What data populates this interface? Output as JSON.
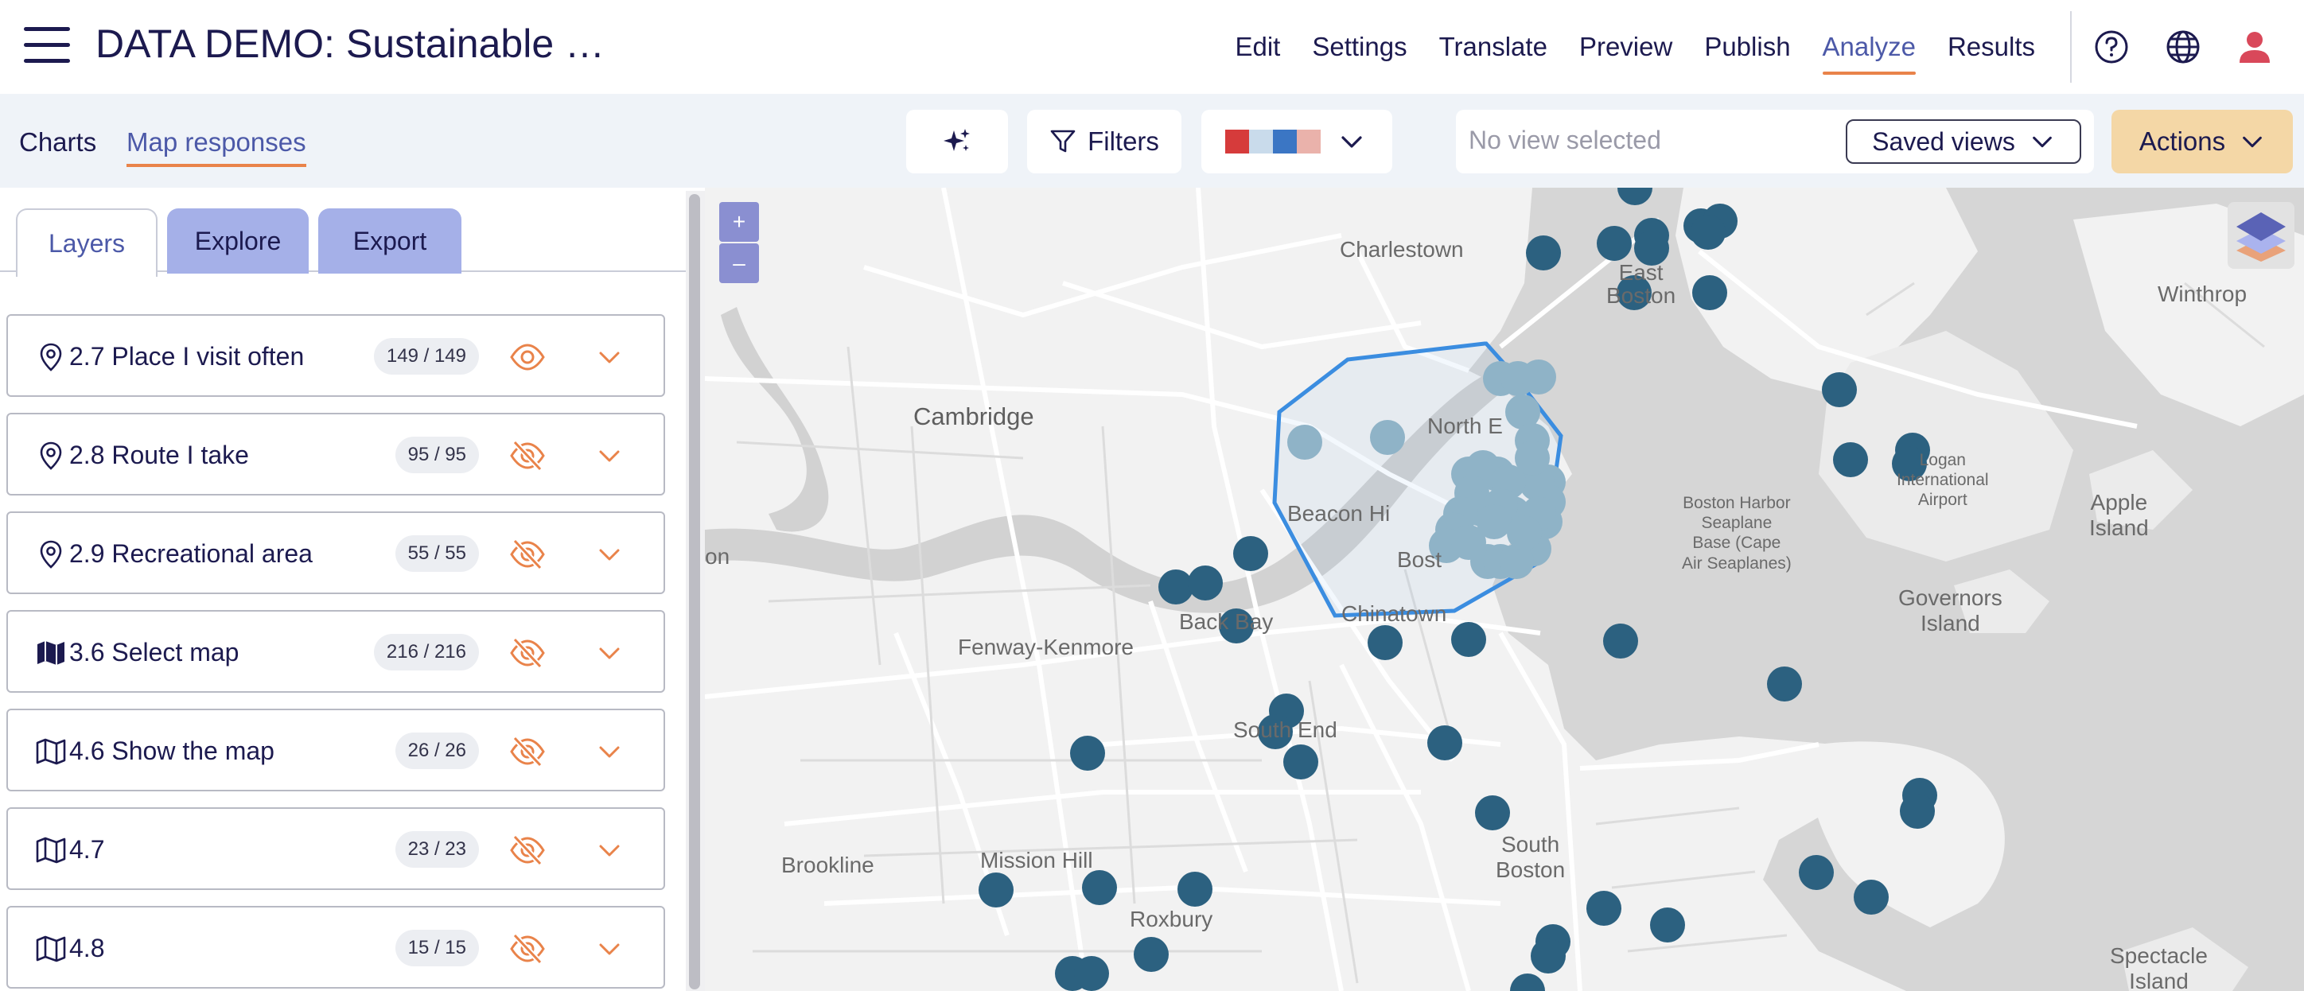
{
  "header": {
    "title": "DATA DEMO: Sustainable …",
    "nav": [
      {
        "label": "Edit"
      },
      {
        "label": "Settings"
      },
      {
        "label": "Translate"
      },
      {
        "label": "Preview"
      },
      {
        "label": "Publish"
      },
      {
        "label": "Analyze",
        "active": true
      },
      {
        "label": "Results"
      }
    ],
    "icons": [
      "help-icon",
      "globe-icon",
      "user-icon"
    ]
  },
  "subbar": {
    "tabs": [
      {
        "label": "Charts"
      },
      {
        "label": "Map responses",
        "active": true
      }
    ],
    "ai_button_icon": "sparkle-icon",
    "filters_label": "Filters",
    "palette_colors": [
      "#d63b3b",
      "#c9dbeb",
      "#3b76c4",
      "#eab2ab"
    ],
    "view_placeholder": "No view selected",
    "saved_views_label": "Saved views",
    "actions_label": "Actions"
  },
  "panel": {
    "tabs": [
      {
        "label": "Layers",
        "active": true
      },
      {
        "label": "Explore"
      },
      {
        "label": "Export"
      }
    ],
    "layers": [
      {
        "icon": "pin-icon",
        "name": "2.7 Place I visit often",
        "count": "149 / 149",
        "visible": true
      },
      {
        "icon": "pin-icon",
        "name": "2.8 Route I take",
        "count": "95 / 95",
        "visible": false
      },
      {
        "icon": "pin-icon",
        "name": "2.9 Recreational area",
        "count": "55 / 55",
        "visible": false
      },
      {
        "icon": "map-filled-icon",
        "name": "3.6 Select map",
        "count": "216 / 216",
        "visible": false
      },
      {
        "icon": "map-outline-icon",
        "name": "4.6 Show the map",
        "count": "26 / 26",
        "visible": false
      },
      {
        "icon": "map-outline-icon",
        "name": "4.7",
        "count": "23 / 23",
        "visible": false
      },
      {
        "icon": "map-outline-icon",
        "name": "4.8",
        "count": "15 / 15",
        "visible": false
      }
    ]
  },
  "map": {
    "zoom_in": "+",
    "zoom_out": "–",
    "labels": {
      "charlestown": "Charlestown",
      "east_boston": "East\nBoston",
      "winthrop": "Winthrop",
      "cambridge": "Cambridge",
      "north_end": "North E",
      "beacon_hill": "Beacon Hi",
      "boston": "Bost",
      "chinatown": "Chinatown",
      "fenway": "Fenway-Kenmore",
      "back_bay": "Back Bay",
      "south_end": "South End",
      "brookline": "Brookline",
      "mission_hill": "Mission Hill",
      "roxbury": "Roxbury",
      "south_boston": "South\nBoston",
      "airport": "Logan\nInternational\nAirport",
      "seaplane": "Boston Harbor\nSeaplane\nBase (Cape\nAir Seaplanes)",
      "apple_island": "Apple\nIsland",
      "governors_island": "Governors\nIsland",
      "spectacle_island": "Spectacle\nIsland",
      "on": "on"
    },
    "point_color": "#2c6180",
    "selected_point_color": "#8fb3c7",
    "selection_color": "#3b8de0"
  }
}
